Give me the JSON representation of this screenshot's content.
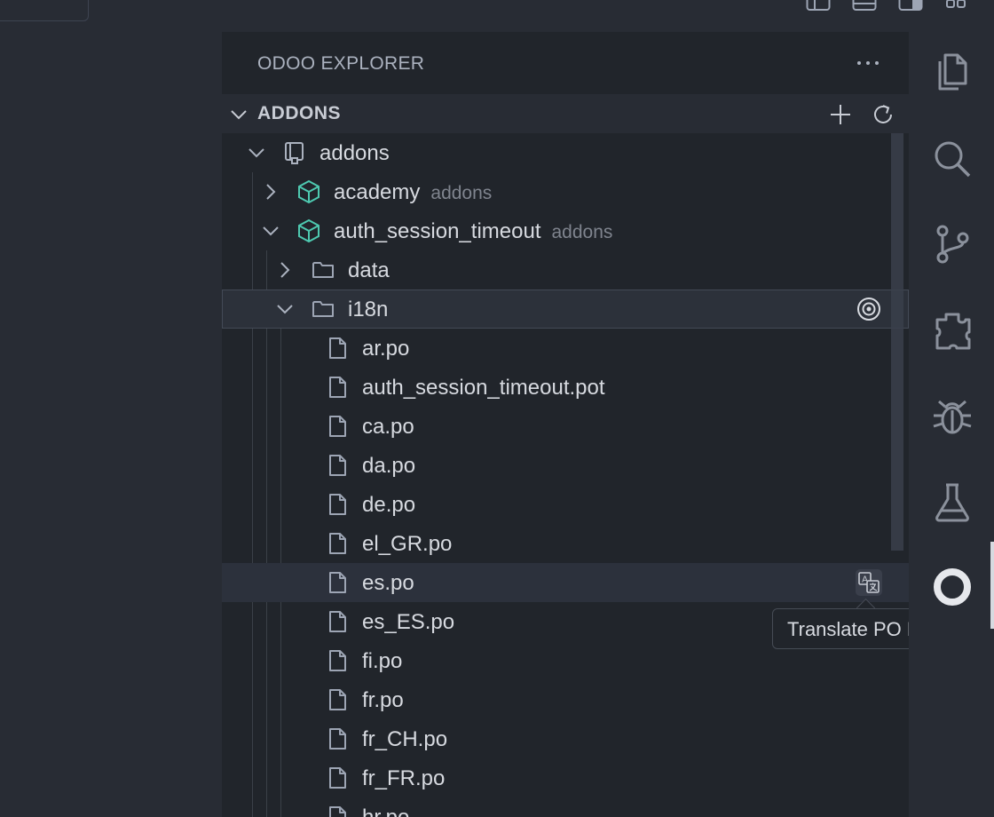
{
  "sidebar": {
    "title": "ODOO EXPLORER",
    "section_title": "ADDONS"
  },
  "tree": {
    "root": {
      "label": "addons"
    },
    "modules": [
      {
        "label": "academy",
        "description": "addons"
      },
      {
        "label": "auth_session_timeout",
        "description": "addons"
      }
    ],
    "folders": [
      {
        "label": "data"
      },
      {
        "label": "i18n"
      }
    ],
    "files": [
      {
        "label": "ar.po"
      },
      {
        "label": "auth_session_timeout.pot"
      },
      {
        "label": "ca.po"
      },
      {
        "label": "da.po"
      },
      {
        "label": "de.po"
      },
      {
        "label": "el_GR.po"
      },
      {
        "label": "es.po"
      },
      {
        "label": "es_ES.po"
      },
      {
        "label": "fi.po"
      },
      {
        "label": "fr.po"
      },
      {
        "label": "fr_CH.po"
      },
      {
        "label": "fr_FR.po"
      },
      {
        "label": "hr.po"
      }
    ]
  },
  "tooltip": {
    "text": "Translate PO File"
  },
  "icons": {
    "module": "package-cube-icon",
    "folder": "folder-icon",
    "file": "file-icon",
    "root": "repo-icon",
    "translate": "translate-icon",
    "reveal": "target-icon"
  },
  "colors": {
    "module_icon": "#4ec9b0",
    "sidebar_bg": "#21252b",
    "editor_bg": "#282c34"
  }
}
